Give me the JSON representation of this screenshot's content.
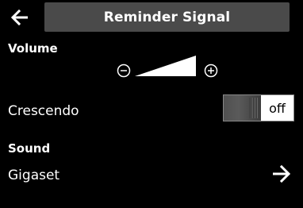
{
  "header": {
    "title": "Reminder Signal",
    "back_icon": "arrow-left-icon"
  },
  "volume": {
    "label": "Volume",
    "minus_icon": "minus-circle-icon",
    "plus_icon": "plus-circle-icon"
  },
  "crescendo": {
    "label": "Crescendo",
    "state": "off"
  },
  "sound": {
    "label": "Sound",
    "value": "Gigaset",
    "next_icon": "arrow-right-icon"
  }
}
